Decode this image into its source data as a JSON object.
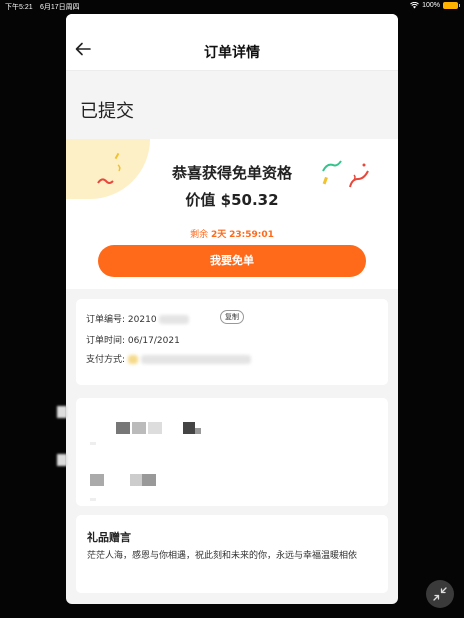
{
  "status_bar": {
    "time": "下午5:21",
    "date": "6月17日周四",
    "battery": "100%",
    "battery_color": "#ffb300"
  },
  "navbar": {
    "title": "订单详情",
    "back_icon": "arrow-left-icon"
  },
  "order_status": "已提交",
  "reward": {
    "title": "恭喜获得免单资格",
    "value_label": "价值",
    "value_amount": "$50.32",
    "countdown_prefix": "剩余",
    "countdown_days": "2天",
    "countdown_time": "23:59:01",
    "cta_label": "我要免单",
    "accent_color": "#ff6a1a"
  },
  "order_info": {
    "number_label": "订单编号:",
    "number_value": "20210",
    "copy_label": "复制",
    "time_label": "订单时间:",
    "time_value": "06/17/2021",
    "payment_label": "支付方式:"
  },
  "gift_message": {
    "title": "礼品赠言",
    "text": "茫茫人海，感恩与你相遇，祝此刻和未来的你，永远与幸福温暖相依"
  },
  "float_button_icon": "minimize-arrows-icon"
}
